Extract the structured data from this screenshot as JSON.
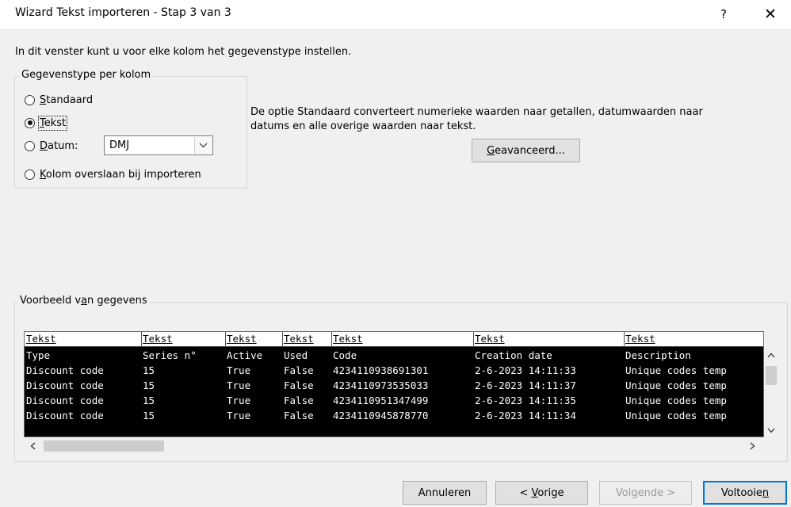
{
  "window": {
    "title": "Wizard Tekst importeren - Stap 3 van 3",
    "help_label": "?",
    "close_label": "✕"
  },
  "intro": "In dit venster kunt u voor elke kolom het gegevenstype instellen.",
  "column_type_group": {
    "legend": "Gegevenstype per kolom",
    "options": [
      {
        "label": "Standaard",
        "accel": "S",
        "rest": "tandaard",
        "checked": false
      },
      {
        "label": "Tekst",
        "accel": "T",
        "rest": "ekst",
        "checked": true
      },
      {
        "label": "Datum:",
        "accel": "D",
        "rest": "atum:",
        "checked": false
      },
      {
        "label": "Kolom overslaan bij importeren",
        "accel": "K",
        "rest": "olom overslaan bij importeren",
        "checked": false
      }
    ],
    "date_format": {
      "value": "DMJ"
    }
  },
  "description": {
    "line1": "De optie Standaard converteert numerieke waarden naar getallen, datumwaarden naar",
    "line2": "datums en alle overige waarden naar tekst."
  },
  "advanced_button": {
    "label": "Geavanceerd...",
    "accel": "G",
    "rest": "eavanceerd..."
  },
  "preview": {
    "legend_pre": "Voorbeeld v",
    "legend_accel": "a",
    "legend_post": "n gegevens",
    "headers": [
      "Tekst",
      "Tekst",
      "Tekst",
      "Tekst",
      "Tekst",
      "Tekst",
      "Tekst"
    ],
    "rows": [
      [
        "Type",
        "Series n°",
        "Active",
        "Used",
        "Code",
        "Creation date",
        "Description"
      ],
      [
        "Discount code",
        "15",
        "True",
        "False",
        "4234110938691301",
        "2-6-2023 14:11:33",
        "Unique codes temp"
      ],
      [
        "Discount code",
        "15",
        "True",
        "False",
        "4234110973535033",
        "2-6-2023 14:11:37",
        "Unique codes temp"
      ],
      [
        "Discount code",
        "15",
        "True",
        "False",
        "4234110951347499",
        "2-6-2023 14:11:35",
        "Unique codes temp"
      ],
      [
        "Discount code",
        "15",
        "True",
        "False",
        "4234110945878770",
        "2-6-2023 14:11:34",
        "Unique codes temp"
      ]
    ]
  },
  "buttons": {
    "cancel": "Annuleren",
    "back_pre": "< ",
    "back_accel": "V",
    "back_post": "orige",
    "next": "Volgende >",
    "finish_pre": "Voltooie",
    "finish_accel": "n"
  }
}
